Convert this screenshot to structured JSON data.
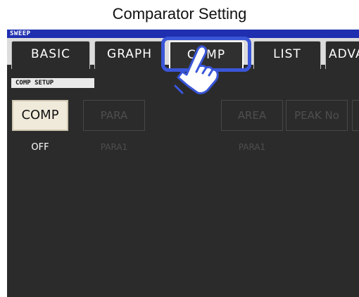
{
  "header": {
    "title": "Comparator Setting"
  },
  "mode": {
    "label": "SWEEP"
  },
  "tabs": [
    {
      "label": "BASIC"
    },
    {
      "label": "GRAPH"
    },
    {
      "label": "COMP",
      "active": true
    },
    {
      "label": "LIST"
    },
    {
      "label": "ADVA"
    }
  ],
  "section": {
    "label": "COMP SETUP"
  },
  "buttons": [
    {
      "label": "COMP",
      "value": "OFF",
      "enabled": true
    },
    {
      "label": "PARA",
      "value": "PARA1",
      "enabled": false
    },
    {
      "label": "AREA",
      "value": "PARA1",
      "enabled": false
    },
    {
      "label": "PEAK No",
      "value": "",
      "enabled": false
    },
    {
      "label": "",
      "value": "",
      "enabled": false
    }
  ],
  "icons": {
    "hand": "pointing-hand-icon"
  },
  "colors": {
    "mode_bar": "#1f2fb0",
    "highlight": "#3a56d8",
    "active_button": "#f0eadb",
    "screen": "#2b2b2b"
  }
}
